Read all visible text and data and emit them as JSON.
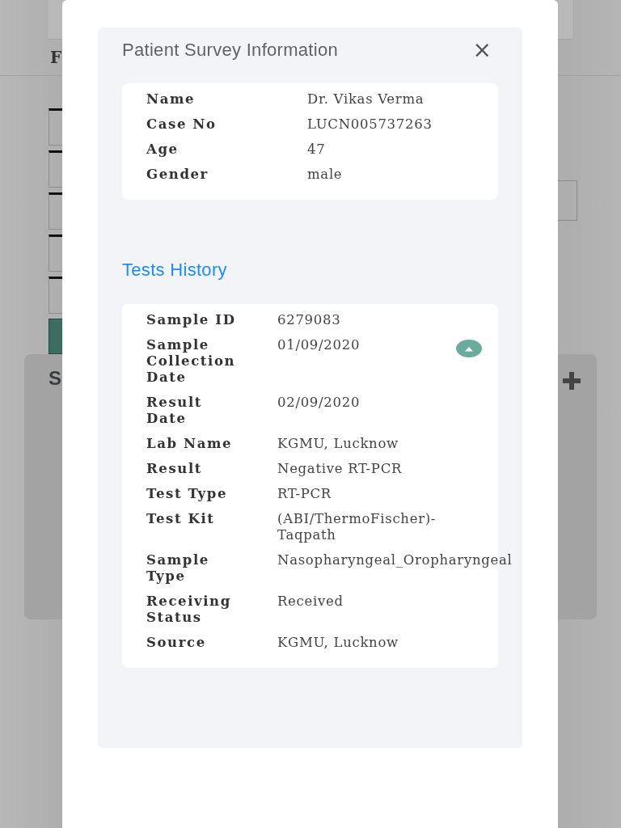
{
  "backdrop": {
    "page_letter": "F",
    "section_letter": "S"
  },
  "dialog": {
    "title": "Patient Survey Information",
    "close": "×",
    "patient": [
      {
        "label": "Name",
        "value": "Dr. Vikas Verma"
      },
      {
        "label": "Case No",
        "value": "LUCN005737263"
      },
      {
        "label": "Age",
        "value": "47"
      },
      {
        "label": "Gender",
        "value": "male"
      }
    ],
    "history_title": "Tests History",
    "tests": [
      {
        "expanded": true,
        "fields": [
          {
            "label": "Sample ID",
            "value": "6279083"
          },
          {
            "label": "Sample Collection Date",
            "value": "01/09/2020"
          },
          {
            "label": "Result Date",
            "value": "02/09/2020"
          },
          {
            "label": "Lab Name",
            "value": "KGMU, Lucknow"
          },
          {
            "label": "Result",
            "value": "Negative RT-PCR"
          },
          {
            "label": "Test Type",
            "value": "RT-PCR"
          },
          {
            "label": "Test Kit",
            "value": "(ABI/ThermoFischer)-Taqpath"
          },
          {
            "label": "Sample Type",
            "value": "Nasopharyngeal_Oropharyngeal"
          },
          {
            "label": "Receiving Status",
            "value": "Received"
          },
          {
            "label": "Source",
            "value": "KGMU, Lucknow"
          }
        ]
      }
    ]
  }
}
